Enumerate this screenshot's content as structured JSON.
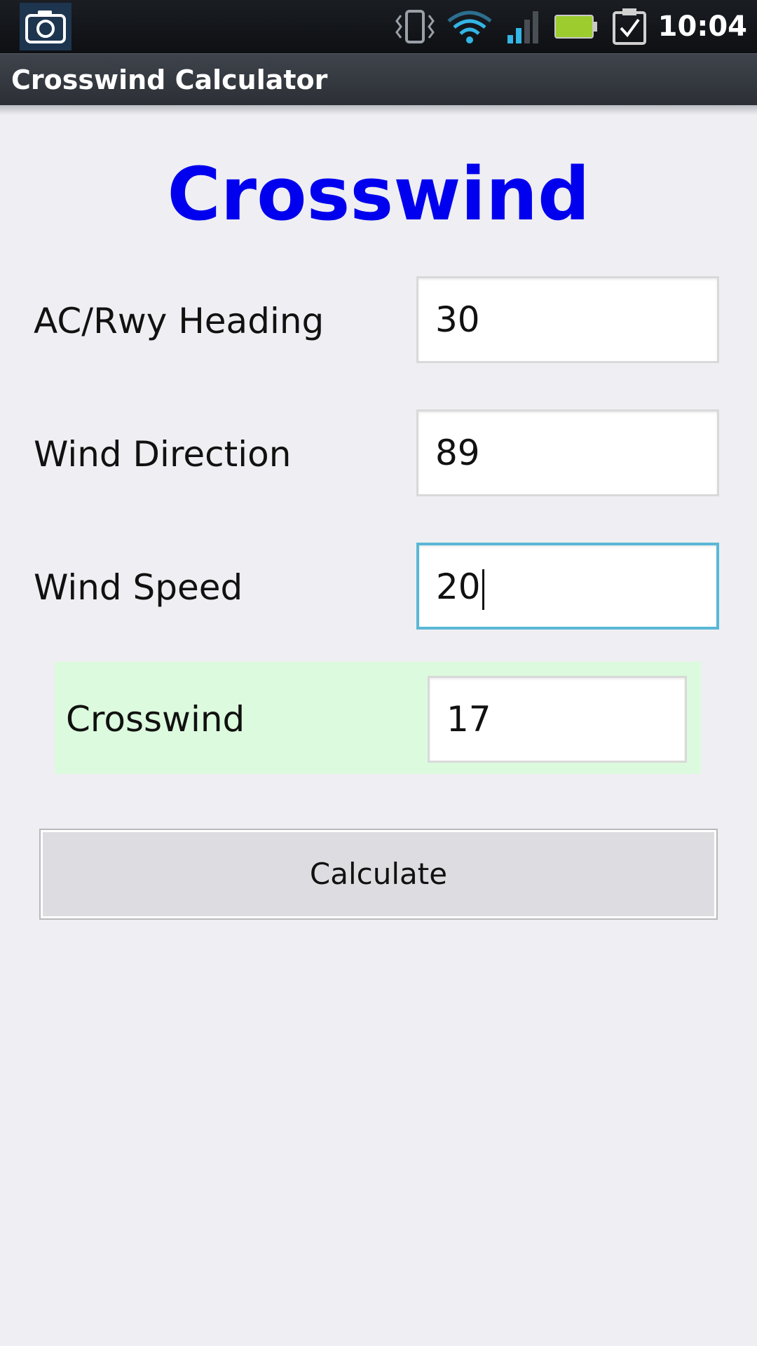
{
  "status_bar": {
    "time": "10:04",
    "icons": [
      "camera-icon",
      "vibrate-icon",
      "wifi-icon",
      "signal-icon",
      "battery-icon",
      "task-icon"
    ],
    "accent_color": "#33b5e5",
    "battery_color": "#9ccc2e"
  },
  "app_bar": {
    "title": "Crosswind Calculator"
  },
  "main": {
    "heading": "Crosswind",
    "heading_color": "#0000ee",
    "fields": {
      "heading": {
        "label": "AC/Rwy Heading",
        "value": "30"
      },
      "wind_direction": {
        "label": "Wind Direction",
        "value": "89"
      },
      "wind_speed": {
        "label": "Wind Speed",
        "value": "20"
      }
    },
    "result": {
      "label": "Crosswind",
      "value": "17",
      "background": "#dcfadd"
    },
    "calculate_label": "Calculate"
  }
}
